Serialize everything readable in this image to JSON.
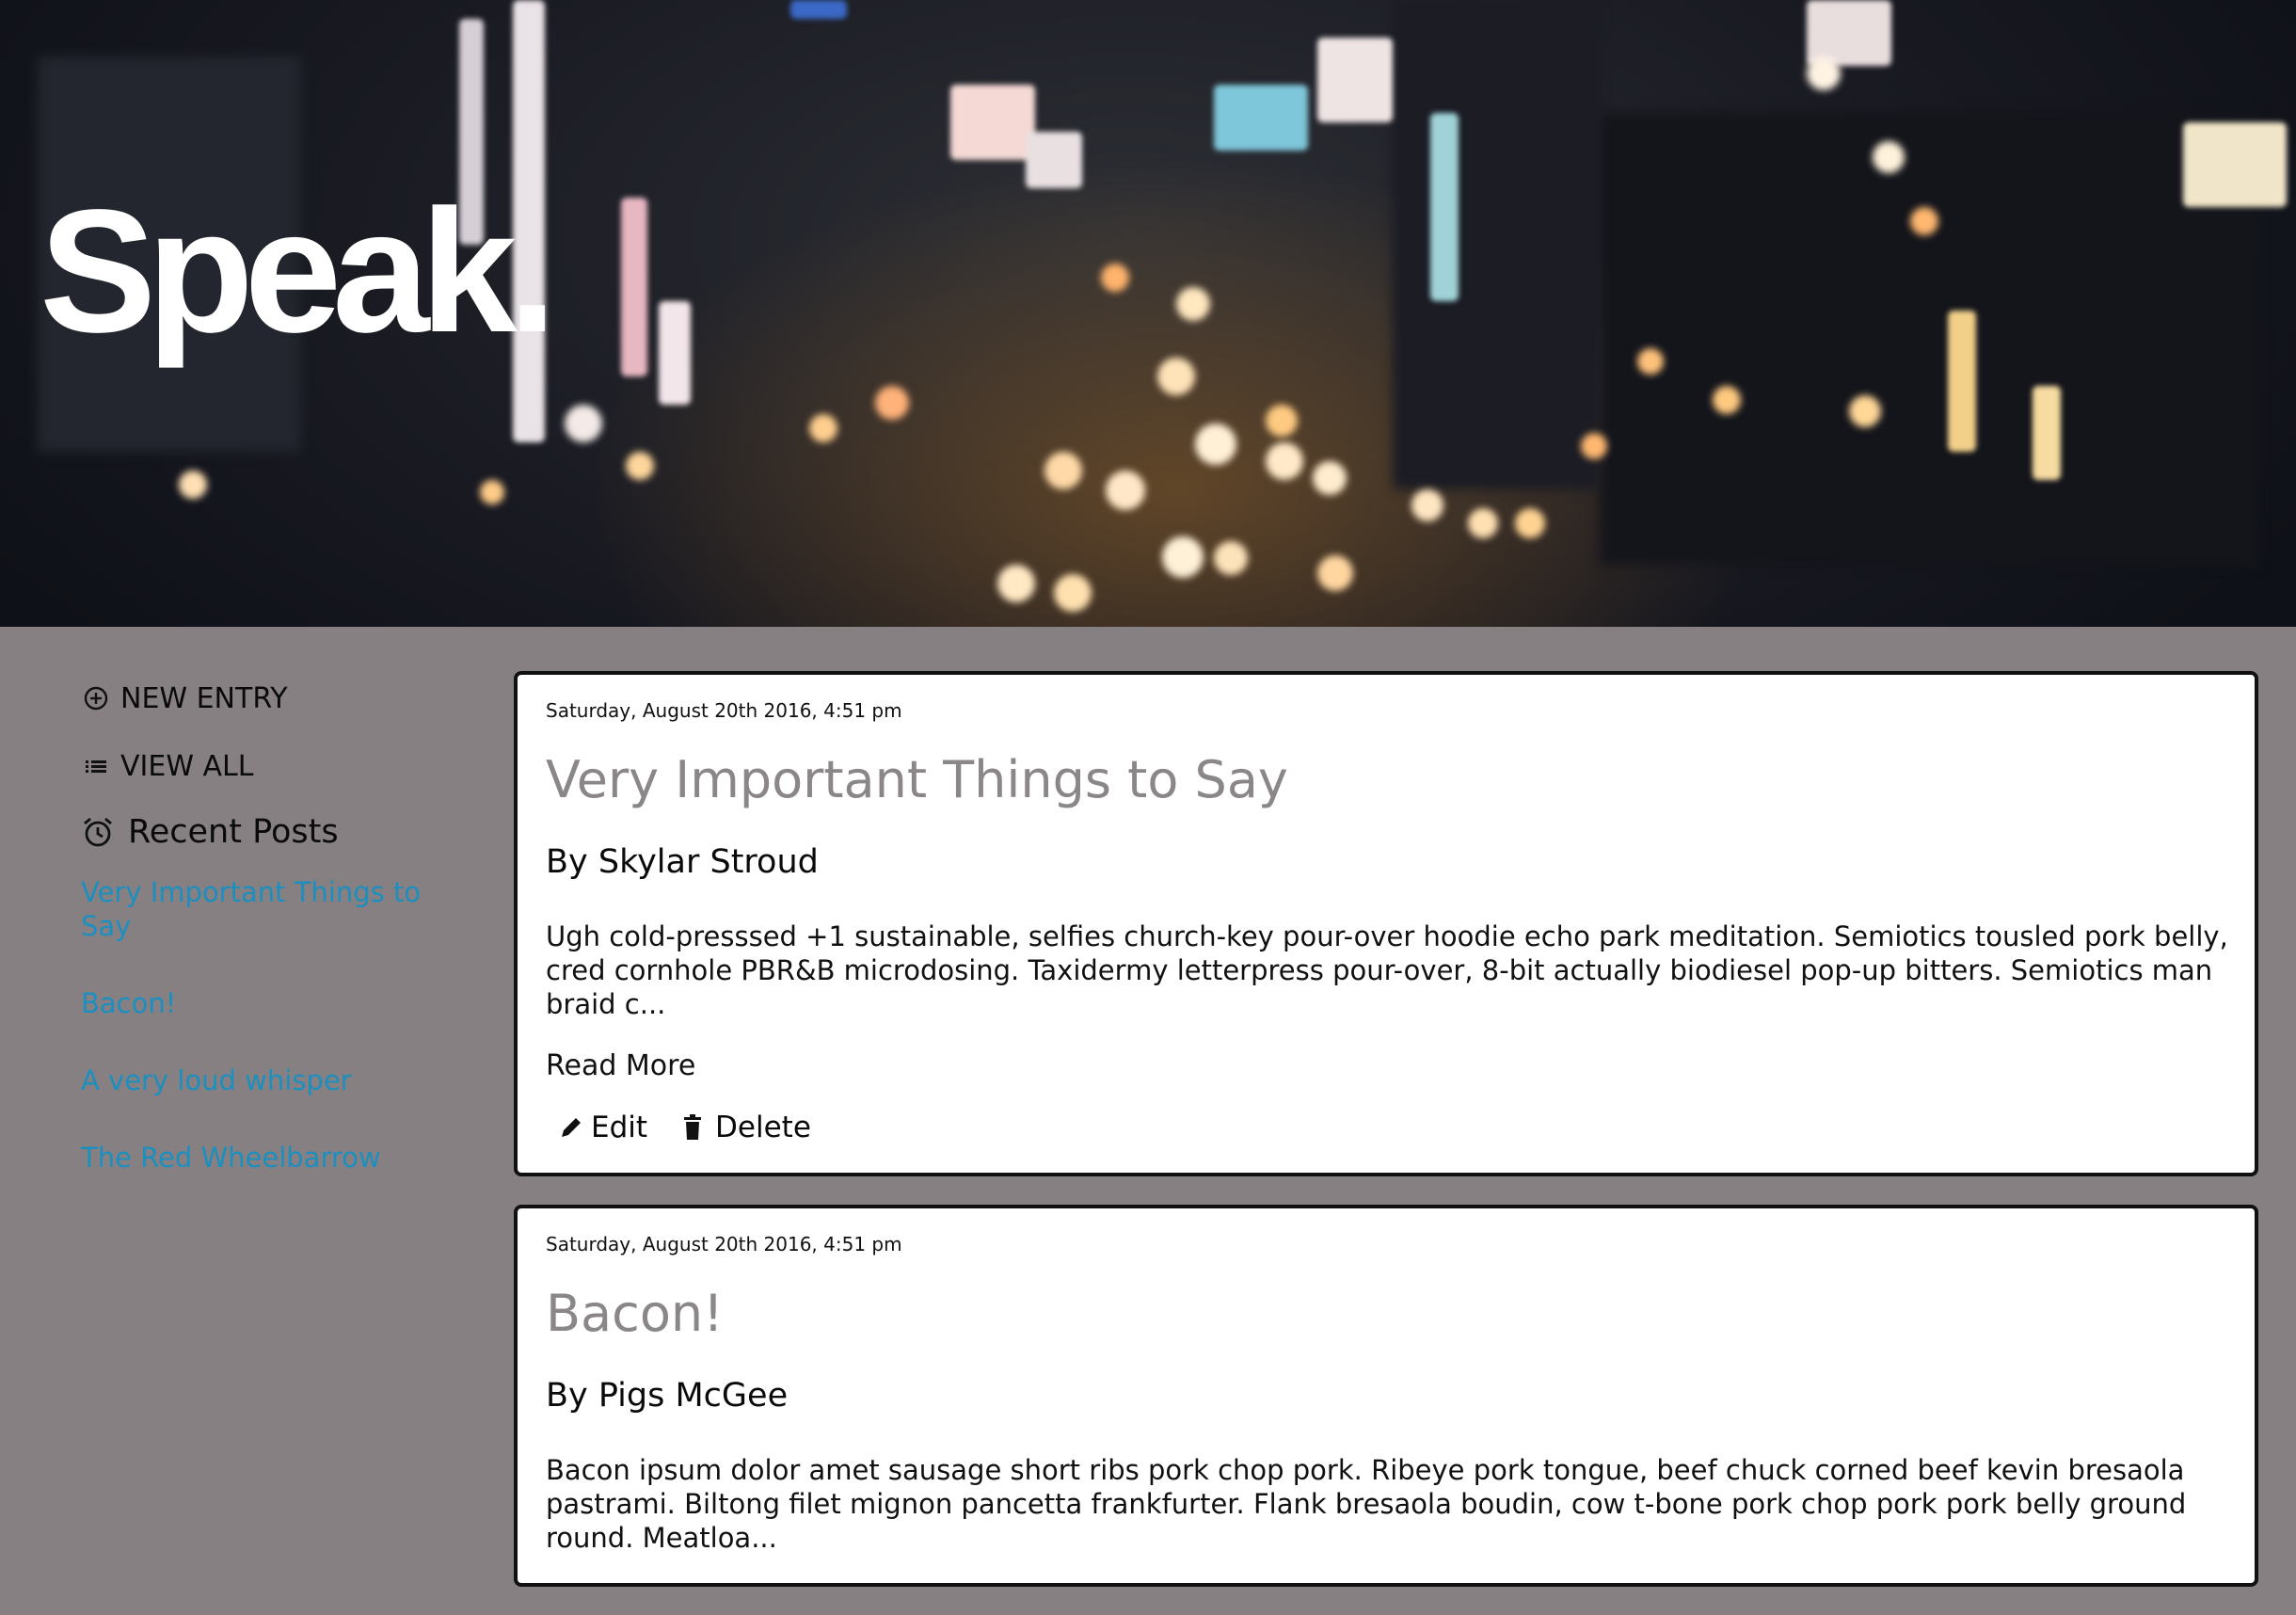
{
  "app": {
    "logo_text": "Speak."
  },
  "sidebar": {
    "nav": [
      {
        "label": "NEW ENTRY",
        "icon": "plus-circle-icon"
      },
      {
        "label": "VIEW ALL",
        "icon": "list-icon"
      }
    ],
    "recent_heading": "Recent Posts",
    "recent_icon": "alarm-clock-icon",
    "recent_posts": [
      "Very Important Things to Say",
      "Bacon!",
      "A very loud whisper",
      "The Red Wheelbarrow"
    ]
  },
  "posts": [
    {
      "date": "Saturday, August 20th 2016, 4:51 pm",
      "title": "Very Important Things to Say",
      "author": "By Skylar Stroud",
      "excerpt": "Ugh cold-presssed +1 sustainable, selfies church-key pour-over hoodie echo park meditation. Semiotics tousled pork belly, cred cornhole PBR&B microdosing. Taxidermy letterpress pour-over, 8-bit actually biodiesel pop-up bitters. Semiotics man braid c...",
      "read_more": "Read More",
      "edit_label": "Edit",
      "delete_label": "Delete"
    },
    {
      "date": "Saturday, August 20th 2016, 4:51 pm",
      "title": "Bacon!",
      "author": "By Pigs McGee",
      "excerpt": "Bacon ipsum dolor amet sausage short ribs pork chop pork. Ribeye pork tongue, beef chuck corned beef kevin bresaola pastrami. Biltong filet mignon pancetta frankfurter. Flank bresaola boudin, cow t-bone pork chop pork pork belly ground round. Meatloa..."
    }
  ],
  "colors": {
    "page_background": "#878082",
    "link": "#1b8fbf",
    "post_title": "#8b8688",
    "card_background": "#ffffff",
    "card_border": "#111111"
  }
}
